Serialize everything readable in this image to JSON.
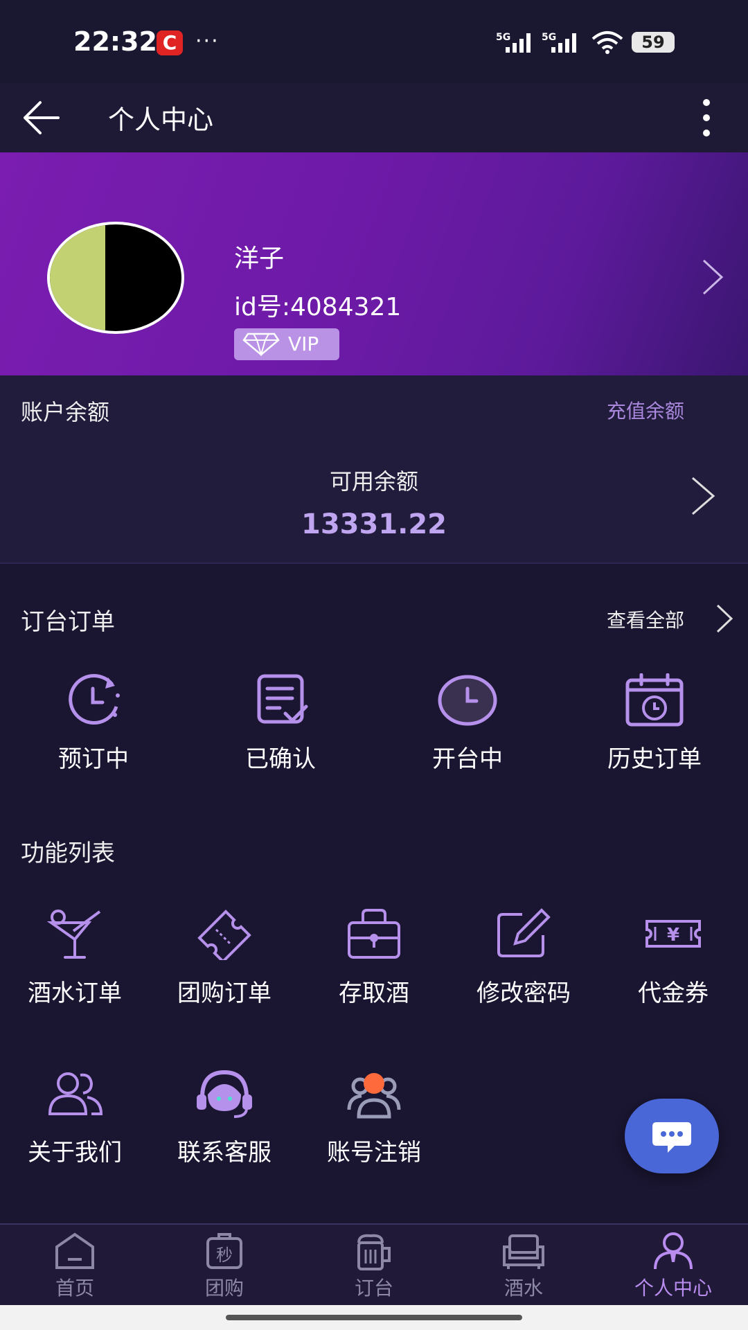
{
  "status_bar": {
    "time": "22:32",
    "app_badge": "C",
    "more": "···",
    "network_1": "5G",
    "network_2": "5G",
    "battery": "59"
  },
  "header": {
    "title": "个人中心"
  },
  "profile": {
    "name": "洋子",
    "id_text": "id号:4084321",
    "vip_label": "VIP"
  },
  "balance": {
    "title": "账户余额",
    "recharge_label": "充值余额",
    "available_label": "可用余额",
    "available_amount": "13331.22"
  },
  "orders": {
    "title": "订台订单",
    "view_all": "查看全部",
    "items": [
      {
        "label": "预订中",
        "icon": "clock-refresh-icon"
      },
      {
        "label": "已确认",
        "icon": "document-check-icon"
      },
      {
        "label": "开台中",
        "icon": "clock-icon"
      },
      {
        "label": "历史订单",
        "icon": "calendar-history-icon"
      }
    ]
  },
  "functions": {
    "title": "功能列表",
    "items": [
      {
        "label": "酒水订单",
        "icon": "cocktail-icon"
      },
      {
        "label": "团购订单",
        "icon": "ticket-icon"
      },
      {
        "label": "存取酒",
        "icon": "locker-icon"
      },
      {
        "label": "修改密码",
        "icon": "edit-icon"
      },
      {
        "label": "代金券",
        "icon": "voucher-icon"
      },
      {
        "label": "关于我们",
        "icon": "users-icon"
      },
      {
        "label": "联系客服",
        "icon": "headset-icon"
      },
      {
        "label": "账号注销",
        "icon": "account-cancel-icon"
      }
    ]
  },
  "tabs": [
    {
      "label": "首页",
      "icon": "home-icon"
    },
    {
      "label": "团购",
      "icon": "flash-sale-icon",
      "glyph": "秒"
    },
    {
      "label": "订台",
      "icon": "beer-icon"
    },
    {
      "label": "酒水",
      "icon": "sofa-icon"
    },
    {
      "label": "个人中心",
      "icon": "person-icon",
      "active": true
    }
  ],
  "colors": {
    "accent": "#b98cf0",
    "profile_bg": "#7a1db0",
    "fab": "#4a67d8",
    "background": "#1a1530"
  }
}
